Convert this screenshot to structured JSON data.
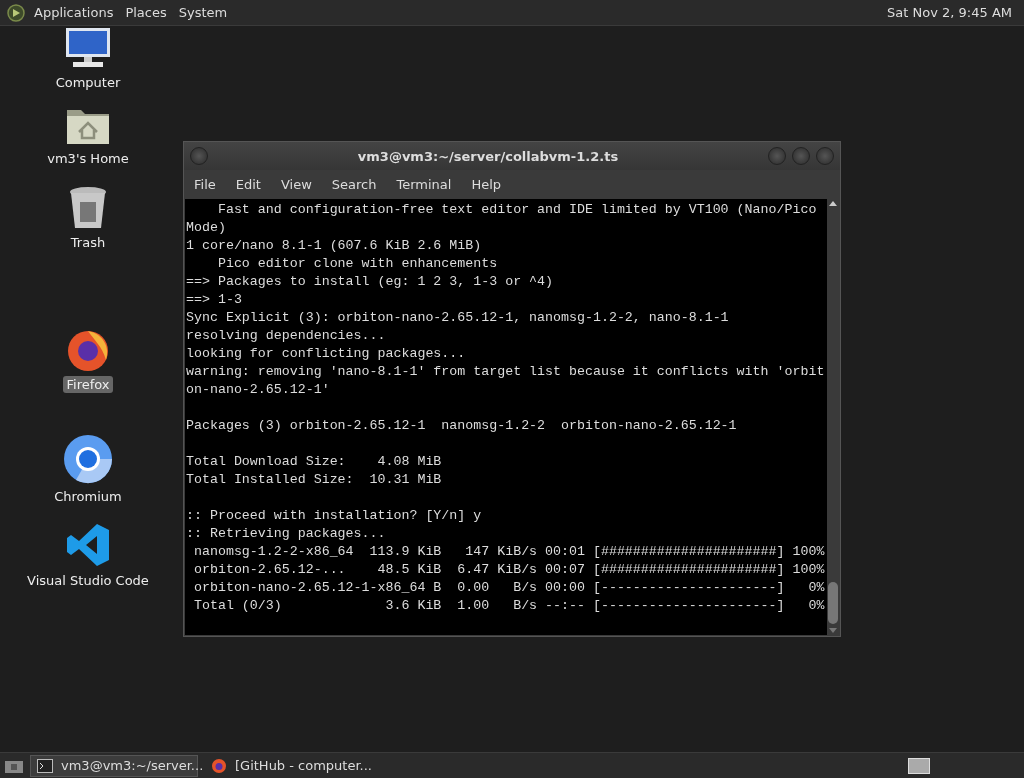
{
  "top_panel": {
    "menus": [
      "Applications",
      "Places",
      "System"
    ],
    "clock": "Sat Nov 2, 9:45 AM"
  },
  "desktop_icons": [
    {
      "kind": "computer",
      "label": "Computer",
      "selected": false
    },
    {
      "kind": "home",
      "label": "vm3's Home",
      "selected": false
    },
    {
      "kind": "trash",
      "label": "Trash",
      "selected": false
    },
    {
      "kind": "firefox",
      "label": "Firefox",
      "selected": true
    },
    {
      "kind": "chromium",
      "label": "Chromium",
      "selected": false
    },
    {
      "kind": "vscode",
      "label": "Visual Studio Code",
      "selected": false
    }
  ],
  "terminal": {
    "title": "vm3@vm3:~/server/collabvm-1.2.ts",
    "menu": [
      "File",
      "Edit",
      "View",
      "Search",
      "Terminal",
      "Help"
    ],
    "blocks": [
      [
        "    Fast and configuration-free text editor and IDE limited by VT100 (Nano/Pico",
        "Mode)",
        "1 core/nano 8.1-1 (607.6 KiB 2.6 MiB)",
        "    Pico editor clone with enhancements",
        "==> Packages to install (eg: 1 2 3, 1-3 or ^4)",
        "==> 1-3",
        "Sync Explicit (3): orbiton-nano-2.65.12-1, nanomsg-1.2-2, nano-8.1-1",
        "resolving dependencies...",
        "looking for conflicting packages...",
        "warning: removing 'nano-8.1-1' from target list because it conflicts with 'orbit",
        "on-nano-2.65.12-1'"
      ],
      [
        "Packages (3) orbiton-2.65.12-1  nanomsg-1.2-2  orbiton-nano-2.65.12-1"
      ],
      [
        "Total Download Size:    4.08 MiB",
        "Total Installed Size:  10.31 MiB"
      ],
      [
        ":: Proceed with installation? [Y/n] y",
        ":: Retrieving packages...",
        " nanomsg-1.2-2-x86_64  113.9 KiB   147 KiB/s 00:01 [######################] 100%",
        " orbiton-2.65.12-...    48.5 KiB  6.47 KiB/s 00:07 [######################] 100%",
        " orbiton-nano-2.65.12-1-x86_64 B  0.00   B/s 00:00 [----------------------]   0%",
        " Total (0/3)             3.6 KiB  1.00   B/s --:-- [----------------------]   0%"
      ]
    ]
  },
  "taskbar": {
    "tasks": [
      {
        "kind": "terminal",
        "label": "vm3@vm3:~/server...",
        "selected": true
      },
      {
        "kind": "firefox",
        "label": "[GitHub - computer...",
        "selected": false
      }
    ]
  }
}
